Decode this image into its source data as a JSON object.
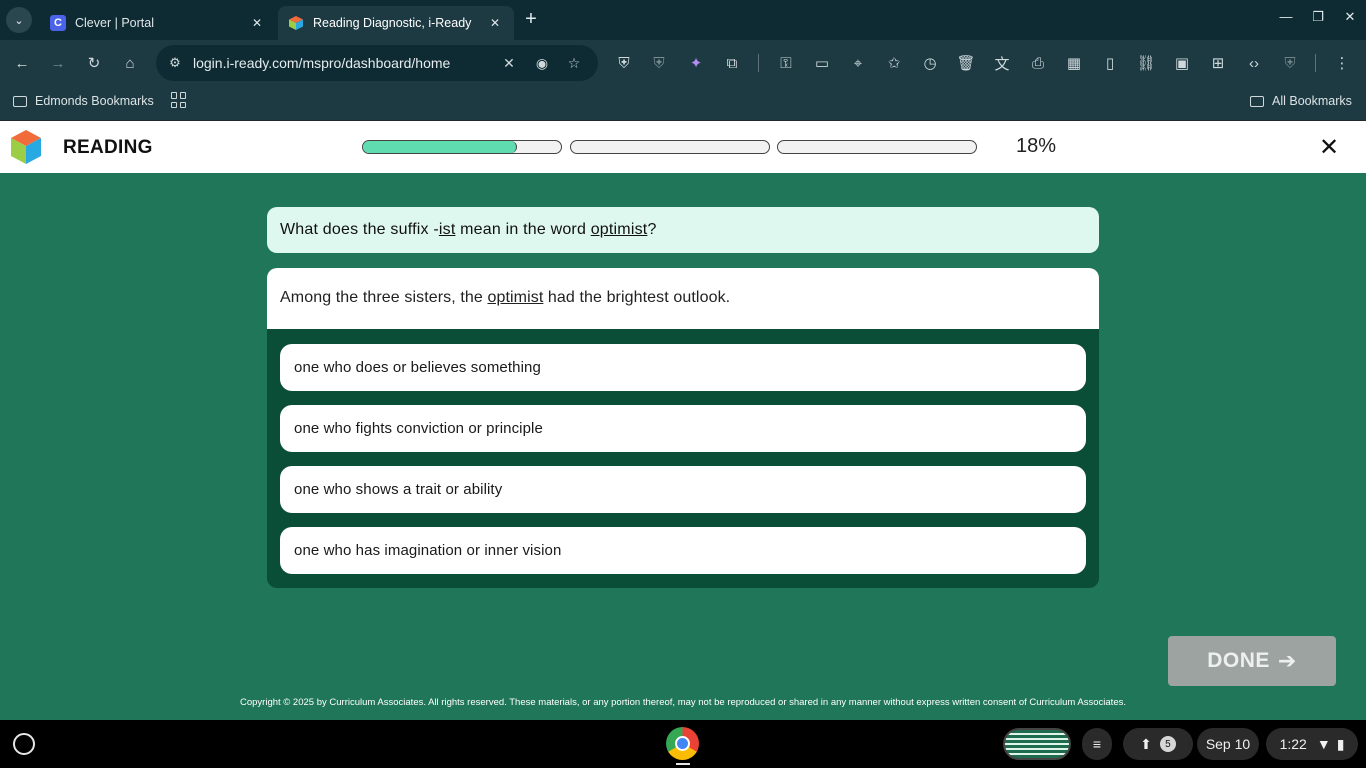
{
  "browser": {
    "tabs": [
      {
        "title": "Clever | Portal",
        "favicon_letter": "C"
      },
      {
        "title": "Reading Diagnostic, i-Ready"
      }
    ],
    "url": "login.i-ready.com/mspro/dashboard/home",
    "bookmarks": {
      "edmonds": "Edmonds Bookmarks",
      "all": "All Bookmarks"
    }
  },
  "page": {
    "subject": "READING",
    "progress": {
      "segments": [
        0.78,
        0.0,
        0.0
      ],
      "percent_label": "18%"
    },
    "question": {
      "prefix": "What does the suffix -",
      "suffix_word": "ist",
      "middle": " mean in the word ",
      "target_word": "optimist",
      "end": "?"
    },
    "passage": {
      "before": "Among the three sisters, the ",
      "target_word": "optimist",
      "after": " had the brightest outlook."
    },
    "choices": [
      "one who does or believes something",
      "one who fights conviction or principle",
      "one who shows a trait or ability",
      "one who has imagination or inner vision"
    ],
    "done_label": "DONE",
    "copyright": "Copyright © 2025 by Curriculum Associates. All rights reserved. These materials, or any portion thereof, may not be reproduced or shared in any manner without express written consent of Curriculum Associates."
  },
  "shelf": {
    "notification_count": "5",
    "date": "Sep 10",
    "time": "1:22"
  },
  "colors": {
    "content_bg": "#207659",
    "card_bg": "#0b4e37",
    "question_bg": "#dff8ef",
    "progress_fill": "#5fdcb0",
    "done_disabled": "#9da3a1"
  }
}
